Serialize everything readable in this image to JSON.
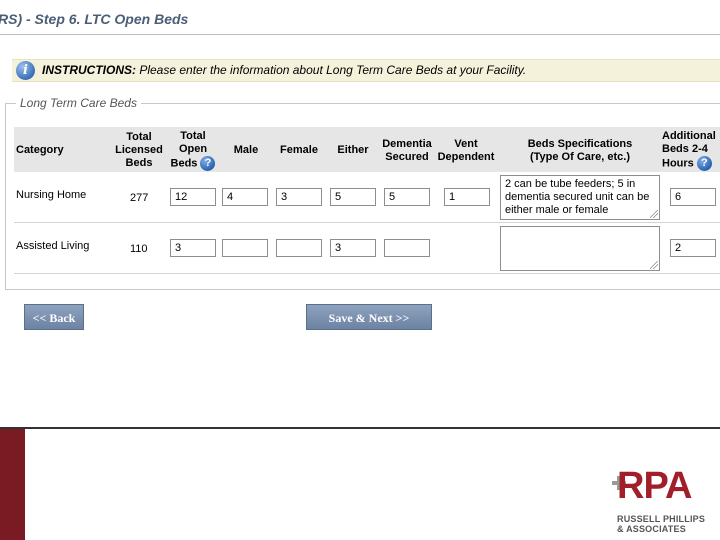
{
  "page": {
    "title": "RS) - Step 6. LTC Open Beds"
  },
  "instructions": {
    "label": "INSTRUCTIONS:",
    "text": " Please enter the information about Long Term Care Beds at your Facility."
  },
  "section": {
    "legend": "Long Term Care Beds"
  },
  "table": {
    "headers": {
      "category": "Category",
      "total_licensed_1": "Total",
      "total_licensed_2": "Licensed",
      "total_licensed_3": "Beds",
      "total_open_1": "Total",
      "total_open_2": "Open",
      "total_open_3": "Beds",
      "male": "Male",
      "female": "Female",
      "either": "Either",
      "dementia_1": "Dementia",
      "dementia_2": "Secured",
      "vent_1": "Vent",
      "vent_2": "Dependent",
      "specs_1": "Beds Specifications",
      "specs_2": "(Type Of Care, etc.)",
      "additional_1": "Additional",
      "additional_2": "Beds 2-4",
      "additional_3": "Hours"
    },
    "help_glyph": "?",
    "rows": [
      {
        "category": "Nursing Home",
        "total_licensed": "277",
        "total_open": "12",
        "male": "4",
        "female": "3",
        "either": "5",
        "dementia": "5",
        "vent": "1",
        "specs": "2 can be tube feeders; 5 in dementia secured unit can be either male or female",
        "additional": "6"
      },
      {
        "category": "Assisted Living",
        "total_licensed": "110",
        "total_open": "3",
        "male": "",
        "female": "",
        "either": "3",
        "dementia": "",
        "specs": "",
        "additional": "2"
      }
    ]
  },
  "buttons": {
    "back": "<< Back",
    "save_next": "Save & Next >>"
  },
  "icons": {
    "info": "info-icon",
    "help": "help-icon"
  },
  "logo": {
    "mark": "RPA",
    "line1": "RUSSELL PHILLIPS",
    "line2": "& ASSOCIATES"
  },
  "colors": {
    "title": "#4a5e78",
    "button": "#7b90ae",
    "instructions_bg": "#f5f2dc",
    "logo_red": "#a01f2a",
    "side_bar": "#7a1a22"
  }
}
